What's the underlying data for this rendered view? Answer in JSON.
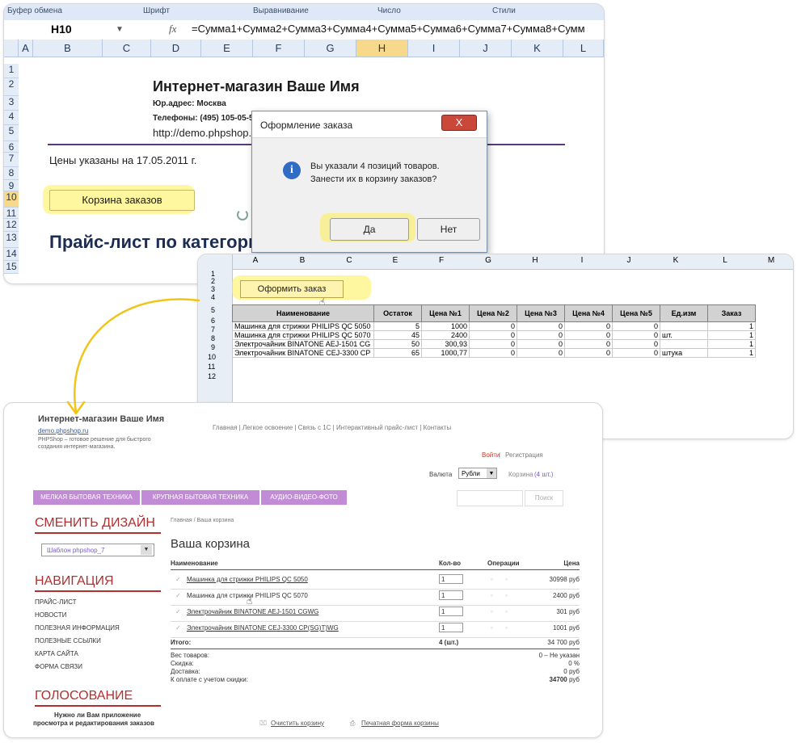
{
  "excel1": {
    "ribbon_groups": [
      "Буфер обмена",
      "Шрифт",
      "Выравнивание",
      "Число",
      "Стили"
    ],
    "namebox": "H10",
    "fx": "fx",
    "formula": "=Сумма1+Сумма2+Сумма3+Сумма4+Сумма5+Сумма6+Сумма7+Сумма8+Сумм",
    "columns": [
      "A",
      "B",
      "C",
      "D",
      "E",
      "F",
      "G",
      "H",
      "I",
      "J",
      "K",
      "L"
    ],
    "rows": [
      "1",
      "2",
      "3",
      "4",
      "5",
      "6",
      "7",
      "8",
      "9",
      "10",
      "11",
      "12",
      "13",
      "14",
      "15"
    ],
    "company": "Интернет-магазин Ваше Имя",
    "address": "Юр.адрес: Москва",
    "phones": "Телефоны: (495) 105-05-5",
    "site": "http://demo.phpshop.",
    "prices_date": "Цены указаны на 17.05.2011 г.",
    "cart_button": "Корзина заказов",
    "pricelist_title": "Прайс-лист по категори",
    "dialog": {
      "title": "Оформление заказа",
      "close": "X",
      "message_line1": "Вы указали 4 позиций товаров.",
      "message_line2": "Занести их в корзину заказов?",
      "yes": "Да",
      "no": "Нет"
    }
  },
  "excel2": {
    "columns": [
      "A",
      "B",
      "C",
      "E",
      "F",
      "G",
      "H",
      "I",
      "J",
      "K",
      "L",
      "M"
    ],
    "order_button": "Оформить заказ",
    "headers": [
      "Наименование",
      "Остаток",
      "Цена №1",
      "Цена №2",
      "Цена №3",
      "Цена №4",
      "Цена №5",
      "Ед.изм",
      "Заказ"
    ],
    "rows": [
      {
        "row": "6",
        "name": "Машинка для стрижки PHILIPS QC 5050",
        "stock": "5",
        "p1": "1000",
        "p2": "0",
        "p3": "0",
        "p4": "0",
        "p5": "0",
        "unit": "",
        "order": "1"
      },
      {
        "row": "7",
        "name": "Машинка для стрижки PHILIPS QC 5070",
        "stock": "45",
        "p1": "2400",
        "p2": "0",
        "p3": "0",
        "p4": "0",
        "p5": "0",
        "unit": "шт.",
        "order": "1"
      },
      {
        "row": "8",
        "name": "Электрочайник BINATONE AEJ-1501 CG",
        "stock": "50",
        "p1": "300,93",
        "p2": "0",
        "p3": "0",
        "p4": "0",
        "p5": "0",
        "unit": "",
        "order": "1"
      },
      {
        "row": "9",
        "name": "Электрочайник BINATONE CEJ-3300 CP",
        "stock": "65",
        "p1": "1000,77",
        "p2": "0",
        "p3": "0",
        "p4": "0",
        "p5": "0",
        "unit": "штука",
        "order": "1"
      }
    ],
    "row_numbers": [
      "1",
      "2",
      "3",
      "4",
      "5",
      "6",
      "7",
      "8",
      "9",
      "10",
      "11",
      "12"
    ]
  },
  "shop": {
    "brand": "Интернет-магазин Ваше Имя",
    "domain": "demo.phpshop.ru",
    "tagline1": "PHPShop – готовое решение для быстрого",
    "tagline2": "создания интернет-магазина.",
    "topnav": "Главная | Легкое освоение | Связь с 1С | Интерактивный прайс-лист | Контакты",
    "login": "Войти",
    "register": "Регистрация",
    "currency_label": "Валюта",
    "currency_value": "Рубли",
    "cart_link": "Корзина",
    "cart_count": "(4 шт.)",
    "categories": [
      "МЕЛКАЯ БЫТОВАЯ ТЕХНИКА",
      "КРУПНАЯ БЫТОВАЯ ТЕХНИКА",
      "АУДИО-ВИДЕО-ФОТО"
    ],
    "search_button": "Поиск",
    "change_design": "СМЕНИТЬ ДИЗАЙН",
    "template_select": "Шаблон phpshop_7",
    "nav_title": "НАВИГАЦИЯ",
    "nav_items": [
      "ПРАЙС-ЛИСТ",
      "НОВОСТИ",
      "ПОЛЕЗНАЯ ИНФОРМАЦИЯ",
      "ПОЛЕЗНЫЕ ССЫЛКИ",
      "КАРТА САЙТА",
      "ФОРМА СВЯЗИ"
    ],
    "vote_title": "ГОЛОСОВАНИЕ",
    "vote_question1": "Нужно ли Вам приложение",
    "vote_question2": "просмотра и редактирования заказов",
    "breadcrumb": "Главная / Ваша корзина",
    "cart_title": "Ваша корзина",
    "cart_headers": [
      "Наименование",
      "Кол-во",
      "Операции",
      "Цена"
    ],
    "cart_items": [
      {
        "name": "Машинка для стрижки PHILIPS QC 5050",
        "qty": "1",
        "price": "30998 руб"
      },
      {
        "name": "Машинка для стрижки PHILIPS QC 5070",
        "qty": "1",
        "price": "2400 руб"
      },
      {
        "name": "Электрочайник BINATONE AEJ-1501 CGWG",
        "qty": "1",
        "price": "301 руб"
      },
      {
        "name": "Электрочайник BINATONE CEJ-3300 CP(SG)T)WG",
        "qty": "1",
        "price": "1001 руб"
      }
    ],
    "total_label": "Итого:",
    "total_qty": "4 (шт.)",
    "total_price": "34 700 руб",
    "weight_label": "Вес товаров:",
    "weight_value": "0 – Не указан",
    "discount_label": "Скидка:",
    "discount_value": "0 %",
    "delivery_label": "Доставка:",
    "delivery_value": "0 руб",
    "pay_label": "К оплате с учетом скидки:",
    "pay_value": "34700",
    "pay_unit": "руб",
    "clear_cart": "Очистить корзину",
    "print_form": "Печатная форма корзины"
  },
  "colors": {
    "highlight": "#fff050",
    "accent_red": "#b12f2f",
    "category_purple": "#c28bd6",
    "arrow": "#f0c419"
  }
}
